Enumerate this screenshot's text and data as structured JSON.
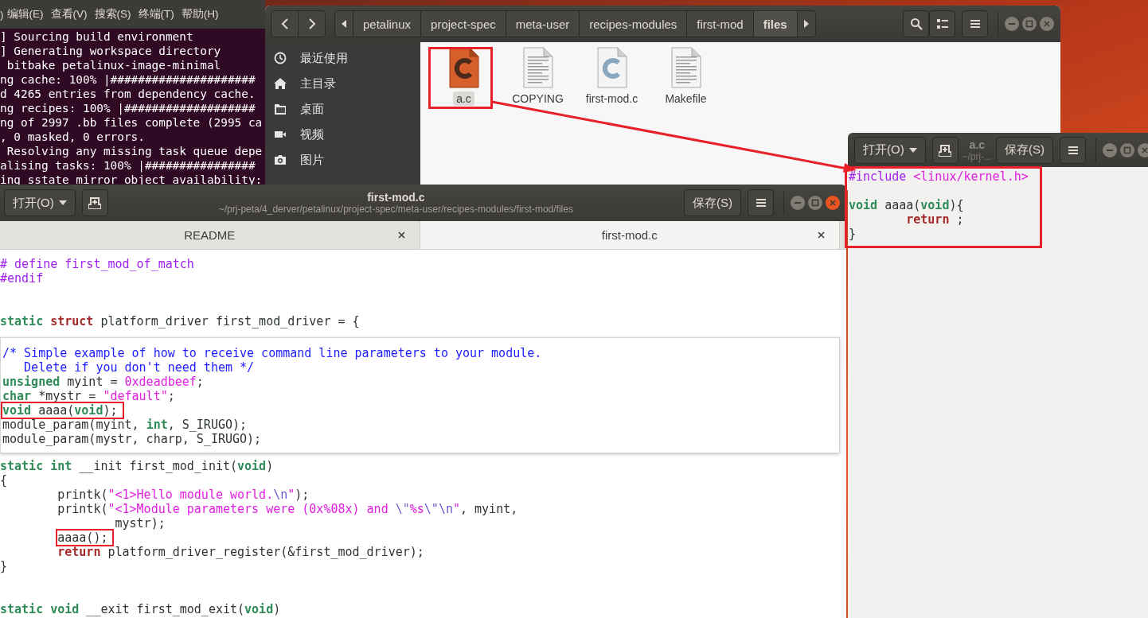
{
  "terminal": {
    "menu": [
      ")",
      "编辑(E)",
      "查看(V)",
      "搜索(S)",
      "终端(T)",
      "帮助(H)"
    ],
    "lines": [
      "] Sourcing build environment",
      "] Generating workspace directory",
      " bitbake petalinux-image-minimal",
      "ng cache: 100% |#####################",
      "d 4265 entries from dependency cache.",
      "ng recipes: 100% |###################",
      "ng of 2997 .bb files complete (2995 ca",
      ", 0 masked, 0 errors.",
      " Resolving any missing task queue depe",
      "alising tasks: 100% |################",
      "ing sstate mirror object availability:"
    ]
  },
  "file_manager": {
    "active": false,
    "breadcrumbs": [
      {
        "label": "petalinux",
        "selected": false
      },
      {
        "label": "project-spec",
        "selected": false
      },
      {
        "label": "meta-user",
        "selected": false
      },
      {
        "label": "recipes-modules",
        "selected": false
      },
      {
        "label": "first-mod",
        "selected": false
      },
      {
        "label": "files",
        "selected": true
      }
    ],
    "sidebar": [
      "最近使用",
      "主目录",
      "桌面",
      "视频",
      "图片"
    ],
    "files": [
      {
        "name": "a.c",
        "kind": "c",
        "selected": true
      },
      {
        "name": "COPYING",
        "kind": "text",
        "selected": false
      },
      {
        "name": "first-mod.c",
        "kind": "c",
        "selected": false
      },
      {
        "name": "Makefile",
        "kind": "text",
        "selected": false
      }
    ]
  },
  "editor_side": {
    "title": "a.c",
    "subtitle": "~/prj-...",
    "open_button": "打开(O)",
    "save_button": "保存(S)",
    "active": false,
    "code": [
      {
        "kind": "code",
        "segments": [
          {
            "kind": "preproc",
            "text": "#include"
          },
          {
            "kind": "string",
            "text": " <linux/kernel.h>"
          }
        ]
      },
      {
        "kind": "blank"
      },
      {
        "kind": "code",
        "segments": [
          {
            "kind": "type",
            "text": "void"
          },
          {
            "kind": "plain",
            "text": " aaaa("
          },
          {
            "kind": "type",
            "text": "void"
          },
          {
            "kind": "plain",
            "text": "){"
          }
        ]
      },
      {
        "kind": "code",
        "segments": [
          {
            "kind": "statement",
            "text": "        return"
          },
          {
            "kind": "plain",
            "text": " ;"
          }
        ]
      },
      {
        "kind": "code",
        "segments": [
          {
            "kind": "plain",
            "text": "}"
          }
        ]
      }
    ]
  },
  "editor_main": {
    "title": "first-mod.c",
    "subtitle": "~/prj-peta/4_derver/petalinux/project-spec/meta-user/recipes-modules/first-mod/files",
    "open_button": "打开(O)",
    "save_button": "保存(S)",
    "active": true,
    "tabs": [
      {
        "label": "README",
        "selected": false
      },
      {
        "label": "first-mod.c",
        "selected": true
      }
    ],
    "code_top": [
      {
        "kind": "code",
        "segments": [
          {
            "kind": "preproc",
            "text": "# define first_mod_of_match"
          }
        ]
      },
      {
        "kind": "code",
        "segments": [
          {
            "kind": "preproc",
            "text": "#endif"
          }
        ]
      },
      {
        "kind": "blank"
      },
      {
        "kind": "blank"
      },
      {
        "kind": "code",
        "segments": [
          {
            "kind": "type",
            "text": "static"
          },
          {
            "kind": "statement",
            "text": " struct"
          },
          {
            "kind": "plain",
            "text": " platform_driver first_mod_driver = {"
          }
        ]
      }
    ],
    "popup": [
      {
        "kind": "code",
        "segments": [
          {
            "kind": "comment",
            "text": "/* Simple example of how to receive command line parameters to your module."
          }
        ]
      },
      {
        "kind": "code",
        "segments": [
          {
            "kind": "comment",
            "text": "   Delete if you don't need them */"
          }
        ]
      },
      {
        "kind": "code",
        "segments": [
          {
            "kind": "type",
            "text": "unsigned"
          },
          {
            "kind": "plain",
            "text": " myint = "
          },
          {
            "kind": "number",
            "text": "0xdeadbeef"
          },
          {
            "kind": "plain",
            "text": ";"
          }
        ]
      },
      {
        "kind": "code",
        "segments": [
          {
            "kind": "type",
            "text": "char"
          },
          {
            "kind": "plain",
            "text": " *mystr = "
          },
          {
            "kind": "string",
            "text": "\"default\""
          },
          {
            "kind": "plain",
            "text": ";"
          }
        ]
      },
      {
        "kind": "code",
        "annotated": true,
        "segments": [
          {
            "kind": "type",
            "text": "void"
          },
          {
            "kind": "plain",
            "text": " aaaa("
          },
          {
            "kind": "type",
            "text": "void"
          },
          {
            "kind": "plain",
            "text": ");"
          }
        ]
      },
      {
        "kind": "code",
        "segments": [
          {
            "kind": "plain",
            "text": "module_param(myint, "
          },
          {
            "kind": "type",
            "text": "int"
          },
          {
            "kind": "plain",
            "text": ", S_IRUGO);"
          }
        ]
      },
      {
        "kind": "code",
        "segments": [
          {
            "kind": "plain",
            "text": "module_param(mystr, charp, S_IRUGO);"
          }
        ]
      }
    ],
    "code_bottom": [
      {
        "kind": "code",
        "segments": [
          {
            "kind": "type",
            "text": "static"
          },
          {
            "kind": "type",
            "text": " int"
          },
          {
            "kind": "plain",
            "text": " __init first_mod_init("
          },
          {
            "kind": "type",
            "text": "void"
          },
          {
            "kind": "plain",
            "text": ")"
          }
        ]
      },
      {
        "kind": "code",
        "segments": [
          {
            "kind": "plain",
            "text": "{"
          }
        ]
      },
      {
        "kind": "code",
        "segments": [
          {
            "kind": "plain",
            "text": "        printk("
          },
          {
            "kind": "string",
            "text": "\"<1>Hello module world."
          },
          {
            "kind": "escape",
            "text": "\\n"
          },
          {
            "kind": "string",
            "text": "\""
          },
          {
            "kind": "plain",
            "text": ");"
          }
        ]
      },
      {
        "kind": "code",
        "segments": [
          {
            "kind": "plain",
            "text": "        printk("
          },
          {
            "kind": "string",
            "text": "\"<1>Module parameters were (0x%08x) and "
          },
          {
            "kind": "escape",
            "text": "\\\""
          },
          {
            "kind": "string",
            "text": "%s"
          },
          {
            "kind": "escape",
            "text": "\\\"\\n"
          },
          {
            "kind": "string",
            "text": "\""
          },
          {
            "kind": "plain",
            "text": ", myint,"
          }
        ]
      },
      {
        "kind": "code",
        "segments": [
          {
            "kind": "plain",
            "text": "                mystr);"
          }
        ]
      },
      {
        "kind": "code",
        "annotated": true,
        "segments": [
          {
            "kind": "plain",
            "text": "        aaaa();"
          }
        ]
      },
      {
        "kind": "code",
        "segments": [
          {
            "kind": "statement",
            "text": "        return"
          },
          {
            "kind": "plain",
            "text": " platform_driver_register(&first_mod_driver);"
          }
        ]
      },
      {
        "kind": "code",
        "segments": [
          {
            "kind": "plain",
            "text": "}"
          }
        ]
      },
      {
        "kind": "blank"
      },
      {
        "kind": "blank"
      },
      {
        "kind": "code",
        "segments": [
          {
            "kind": "type",
            "text": "static"
          },
          {
            "kind": "type",
            "text": " void"
          },
          {
            "kind": "plain",
            "text": " __exit first_mod_exit("
          },
          {
            "kind": "type",
            "text": "void"
          },
          {
            "kind": "plain",
            "text": ")"
          }
        ]
      }
    ]
  }
}
